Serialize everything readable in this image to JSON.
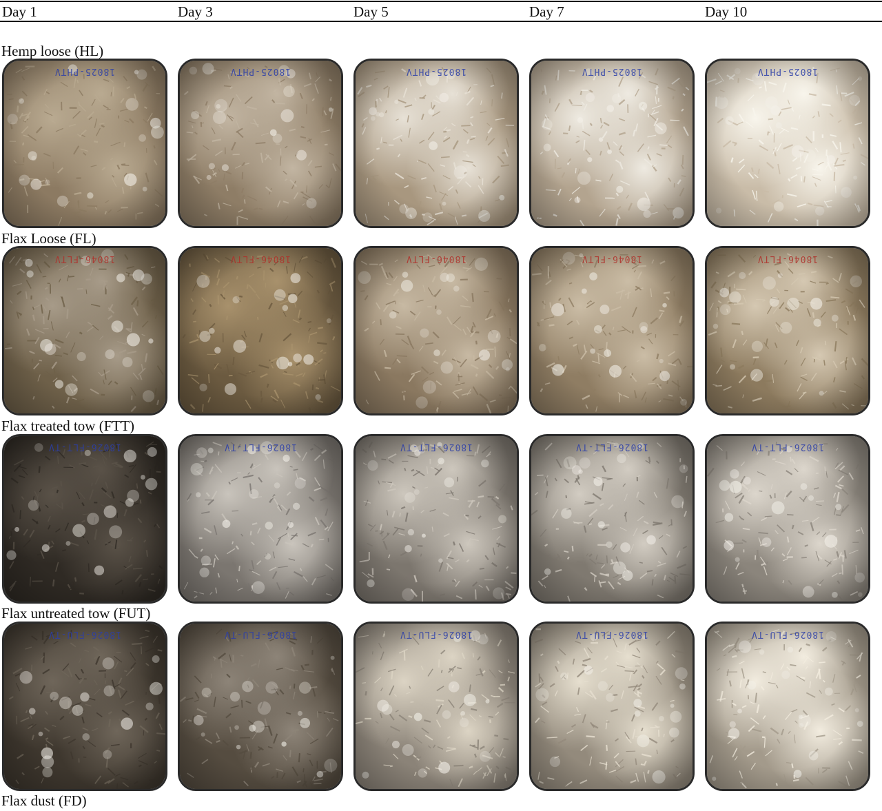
{
  "columns": [
    {
      "label": "Day 1"
    },
    {
      "label": "Day 3"
    },
    {
      "label": "Day 5"
    },
    {
      "label": "Day 7"
    },
    {
      "label": "Day 10"
    }
  ],
  "rows": [
    {
      "label": "Hemp loose (HL)",
      "plate_label": "18025-PHTV",
      "plate_label_color": "#2c3fa8",
      "tones": [
        [
          "#8c7a62",
          "#b9aa91"
        ],
        [
          "#8e7d66",
          "#c2b5a2"
        ],
        [
          "#a8977f",
          "#e7e1d6"
        ],
        [
          "#b3a48f",
          "#eeeae1"
        ],
        [
          "#c9bca8",
          "#f8f5ec"
        ]
      ]
    },
    {
      "label": "Flax Loose (FL)",
      "plate_label": "18046-FLTV",
      "plate_label_color": "#b0302a",
      "tones": [
        [
          "#6e6049",
          "#a79b89"
        ],
        [
          "#6b5a40",
          "#a8916c"
        ],
        [
          "#8a7860",
          "#c7b9a3"
        ],
        [
          "#8f7d63",
          "#cbbda6"
        ],
        [
          "#8c7a5e",
          "#d5c8b2"
        ]
      ]
    },
    {
      "label": "Flax treated tow (FTT)",
      "plate_label": "18026-FLT-TV",
      "plate_label_color": "#2c3fa8",
      "tones": [
        [
          "#2f2a24",
          "#5a5248"
        ],
        [
          "#7b7670",
          "#c9c4bc"
        ],
        [
          "#7c766e",
          "#cdc7bd"
        ],
        [
          "#7f7970",
          "#d2ccc2"
        ],
        [
          "#8b857c",
          "#dcd6cc"
        ]
      ]
    },
    {
      "label": "Flax untreated tow (FUT)",
      "plate_label": "18026-FLU-TV",
      "plate_label_color": "#2c3fa8",
      "tones": [
        [
          "#3e372e",
          "#6f665a"
        ],
        [
          "#554c40",
          "#8d8478"
        ],
        [
          "#8b8378",
          "#dcd4c4"
        ],
        [
          "#938a7c",
          "#e6dfcf"
        ],
        [
          "#a39a8b",
          "#f2ecdf"
        ]
      ]
    }
  ],
  "footer_label": "Flax dust (FD)"
}
